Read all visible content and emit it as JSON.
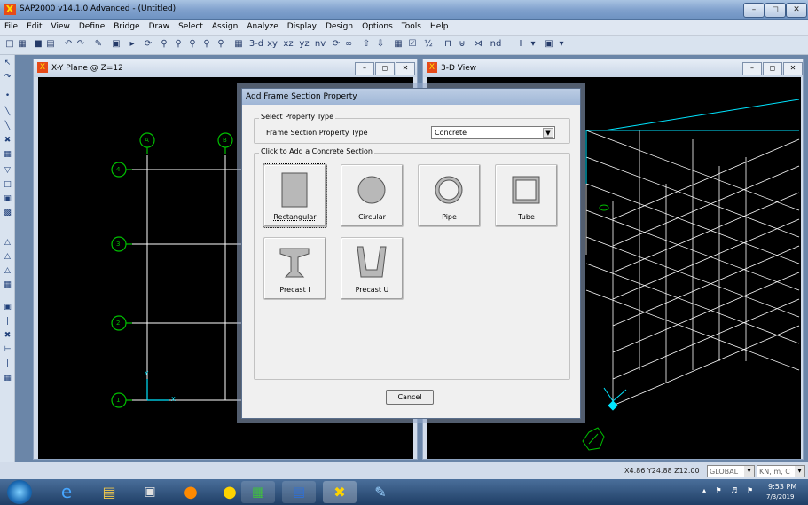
{
  "window": {
    "title": "SAP2000 v14.1.0 Advanced  - (Untitled)",
    "app_icon": "X"
  },
  "menu": [
    "File",
    "Edit",
    "View",
    "Define",
    "Bridge",
    "Draw",
    "Select",
    "Assign",
    "Analyze",
    "Display",
    "Design",
    "Options",
    "Tools",
    "Help"
  ],
  "toolbar_text": {
    "three_d": "3-d",
    "xy": "xy",
    "xz": "xz",
    "yz": "yz",
    "nv": "nv",
    "nd": "nd"
  },
  "left_pane": {
    "title": "X-Y Plane @ Z=12"
  },
  "right_pane": {
    "title": "3-D View"
  },
  "grid_labels": {
    "a": "A",
    "b": "B",
    "r4": "4",
    "r3": "3",
    "r2": "2",
    "r1": "1",
    "x": "X",
    "y": "Y"
  },
  "dialog": {
    "title": "Add Frame Section Property",
    "group1_label": "Select Property Type",
    "type_label": "Frame Section Property Type",
    "type_value": "Concrete",
    "group2_label": "Click to Add a Concrete Section",
    "sections": [
      "Rectangular",
      "Circular",
      "Pipe",
      "Tube",
      "Precast I",
      "Precast U"
    ],
    "cancel": "Cancel"
  },
  "status": {
    "coords": "X4.86  Y24.88  Z12.00",
    "system": "GLOBAL",
    "units": "KN, m, C"
  },
  "clock": {
    "time": "9:53 PM",
    "date": "7/3/2019"
  },
  "colors": {
    "accent": "#00e5ff",
    "grid": "#ffffff",
    "bubble": "#00c000"
  }
}
